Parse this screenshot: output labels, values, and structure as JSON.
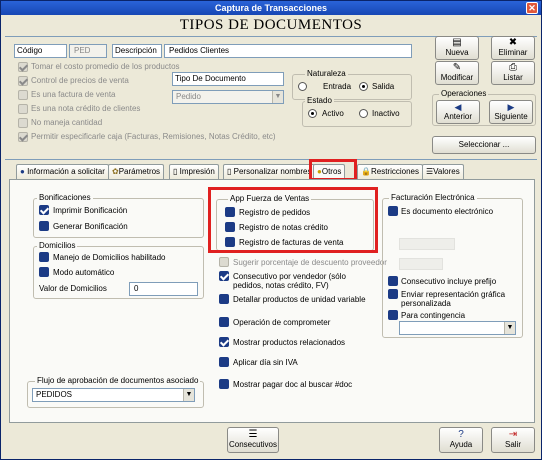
{
  "window": {
    "title": "Captura de Transacciones",
    "heading": "TIPOS DE DOCUMENTOS",
    "close": "✕"
  },
  "header": {
    "codigo_label": "Código",
    "codigo_value": "PED",
    "descripcion_label": "Descripción",
    "descripcion_value": "Pedidos Clientes",
    "checks": [
      {
        "label": "Tomar el costo promedio de los productos",
        "checked": true,
        "disabled": true
      },
      {
        "label": "Control de precios de venta",
        "checked": true,
        "disabled": true
      },
      {
        "label": "Es una factura de venta",
        "checked": false,
        "disabled": true
      },
      {
        "label": "Es una nota crédito de clientes",
        "checked": false,
        "disabled": true
      },
      {
        "label": "No maneja cantidad",
        "checked": false,
        "disabled": true
      },
      {
        "label": "Permitir especificarle caja  (Facturas, Remisiones, Notas Crédito, etc)",
        "checked": true,
        "disabled": true
      }
    ],
    "tipo_label": "Tipo De Documento",
    "tipo_value": "Pedido",
    "naturaleza": {
      "title": "Naturaleza",
      "options": [
        "Entrada",
        "Salida"
      ],
      "selected": "Salida"
    },
    "estado": {
      "title": "Estado",
      "options": [
        "Activo",
        "Inactivo"
      ],
      "selected": "Activo"
    }
  },
  "actions": {
    "nueva": "Nueva",
    "eliminar": "Eliminar",
    "modificar": "Modificar",
    "listar": "Listar",
    "operaciones": "Operaciones",
    "anterior": "Anterior",
    "siguiente": "Siguiente",
    "seleccionar": "Seleccionar ..."
  },
  "tabs": [
    "Información a solicitar",
    "Parámetros",
    "Impresión",
    "Personalizar nombres",
    "Otros",
    "Restricciones",
    "Valores"
  ],
  "active_tab": "Otros",
  "otros": {
    "bonificaciones": {
      "title": "Bonificaciones",
      "items": [
        "Imprimir Bonificación",
        "Generar Bonificación"
      ]
    },
    "domicilios": {
      "title": "Domicilios",
      "items": [
        "Manejo de Domicilios habilitado",
        "Modo automático"
      ],
      "valor_label": "Valor de Domicilios",
      "valor": "0"
    },
    "flujo": {
      "title": "Flujo de aprobación de documentos asociado",
      "value": "PEDIDOS"
    },
    "app": {
      "title": "App Fuerza de Ventas",
      "items": [
        "Registro de pedidos",
        "Registro de notas crédito",
        "Registro de facturas de venta"
      ]
    },
    "mid_items": [
      "Sugerir porcentaje de descuento proveedor",
      "Consecutivo por vendedor (sólo pedidos, notas crédito, FV)",
      "Detallar productos de unidad variable",
      "Operación de comprometer",
      "Mostrar productos relacionados",
      "Aplicar día sin IVA",
      "Mostrar pagar doc al buscar #doc"
    ],
    "facturacion": {
      "title": "Facturación Electrónica",
      "item0": "Es documento electrónico",
      "items": [
        "Consecutivo incluye prefijo",
        "Enviar representación gráfica personalizada",
        "Para contingencia"
      ]
    }
  },
  "footer": {
    "consecutivos": "Consecutivos",
    "ayuda": "Ayuda",
    "salir": "Salir"
  }
}
